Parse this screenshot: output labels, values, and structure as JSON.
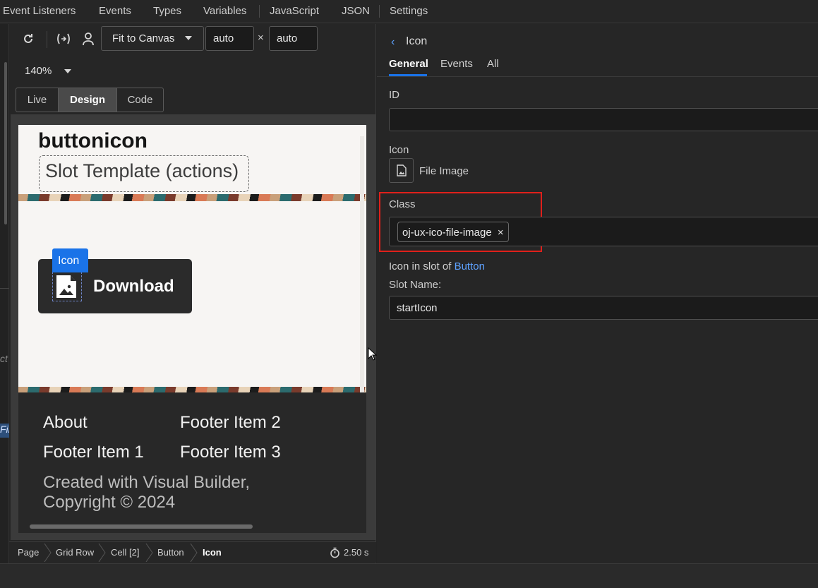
{
  "menu": {
    "items": [
      "Event Listeners",
      "Events",
      "Types",
      "Variables",
      "JavaScript",
      "JSON",
      "Settings"
    ]
  },
  "toolbar": {
    "refresh_icon": "refresh-icon",
    "variables_icon": "variable-binding-icon",
    "user_icon": "user-icon",
    "fit_select": "Fit to Canvas",
    "width_value": "auto",
    "times": "×",
    "height_value": "auto",
    "zoom": "140%"
  },
  "view_modes": {
    "live": "Live",
    "design": "Design",
    "code": "Code",
    "selected": "Design"
  },
  "canvas": {
    "page_title": "buttonicon",
    "slot_placeholder": "Slot Template (actions)",
    "selected_tag": "Icon",
    "button_label": "Download",
    "footer": {
      "col1": [
        "About",
        "Footer Item 1"
      ],
      "col2": [
        "Footer Item 2",
        "Footer Item 3"
      ],
      "credit_line1": "Created with Visual Builder,",
      "credit_line2": "Copyright © 2024"
    }
  },
  "breadcrumb": {
    "items": [
      "Page",
      "Grid Row",
      "Cell [2]",
      "Button",
      "Icon"
    ],
    "timer": "2.50 s"
  },
  "properties": {
    "back_label": "Icon",
    "tabs": [
      "General",
      "Events",
      "All"
    ],
    "active_tab": "General",
    "id_label": "ID",
    "id_value": "",
    "icon_label": "Icon",
    "icon_value": "File Image",
    "class_label": "Class",
    "class_chip": "oj-ux-ico-file-image",
    "chip_close": "×",
    "slot_of_prefix": "Icon in slot of",
    "slot_of_link": "Button",
    "slot_name_label": "Slot Name:",
    "slot_name_value": "startIcon"
  },
  "gutter_fragments": {
    "ct": "ct",
    "fil": "Fil"
  },
  "colors": {
    "accent": "#1a73e8",
    "link": "#5ea2ff",
    "highlight": "#e0201b"
  }
}
